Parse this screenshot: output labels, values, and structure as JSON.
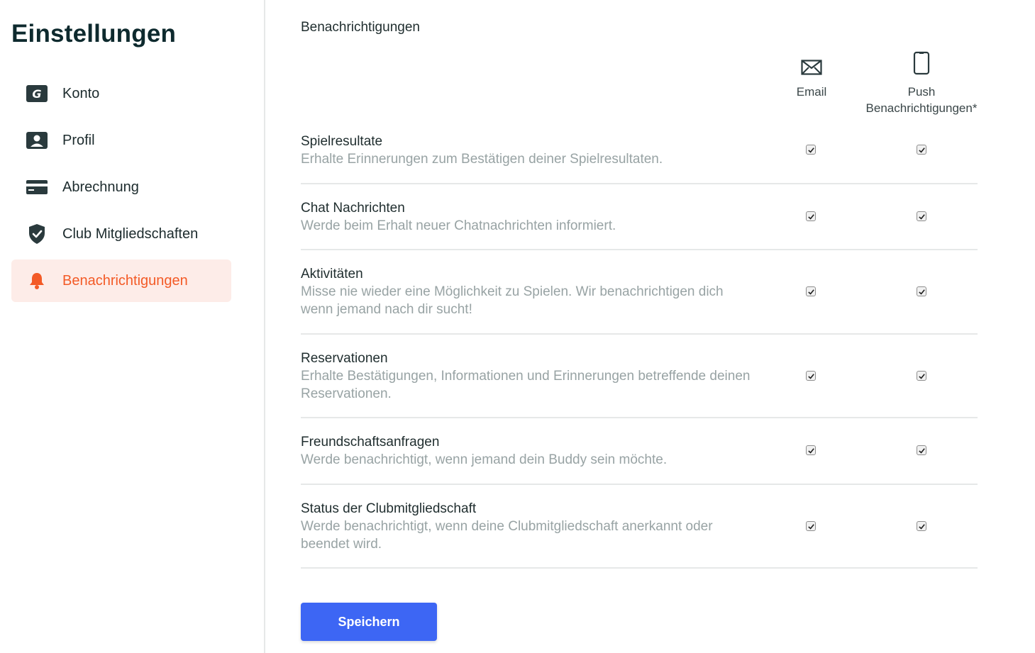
{
  "sidebar": {
    "title": "Einstellungen",
    "items": [
      {
        "label": "Konto",
        "icon": "konto-icon"
      },
      {
        "label": "Profil",
        "icon": "profile-icon"
      },
      {
        "label": "Abrechnung",
        "icon": "credit-card-icon"
      },
      {
        "label": "Club Mitgliedschaften",
        "icon": "shield-check-icon"
      },
      {
        "label": "Benachrichtigungen",
        "icon": "bell-icon",
        "active": true
      }
    ]
  },
  "main": {
    "section_title": "Benachrichtigungen",
    "columns": {
      "email": "Email",
      "push_line1": "Push",
      "push_line2": "Benachrichtigungen*"
    },
    "rows": [
      {
        "title": "Spielresultate",
        "desc": "Erhalte Erinnerungen zum Bestätigen deiner Spielresultaten.",
        "email": true,
        "push": true
      },
      {
        "title": "Chat Nachrichten",
        "desc": "Werde beim Erhalt neuer Chatnachrichten informiert.",
        "email": true,
        "push": true
      },
      {
        "title": "Aktivitäten",
        "desc": "Misse nie wieder eine Möglichkeit zu Spielen. Wir benachrichtigen dich wenn jemand nach dir sucht!",
        "email": true,
        "push": true
      },
      {
        "title": "Reservationen",
        "desc": "Erhalte Bestätigungen, Informationen und Erinnerungen betreffende deinen Reservationen.",
        "email": true,
        "push": true
      },
      {
        "title": "Freundschaftsanfragen",
        "desc": "Werde benachrichtigt, wenn jemand dein Buddy sein möchte.",
        "email": true,
        "push": true
      },
      {
        "title": "Status der Clubmitgliedschaft",
        "desc": "Werde benachrichtigt, wenn deine Clubmitgliedschaft anerkannt oder beendet wird.",
        "email": true,
        "push": true
      }
    ],
    "save_label": "Speichern"
  },
  "colors": {
    "accent": "#f35a26",
    "active_bg": "#fdece8",
    "button": "#3d66f4",
    "muted_text": "#98a3a4"
  }
}
